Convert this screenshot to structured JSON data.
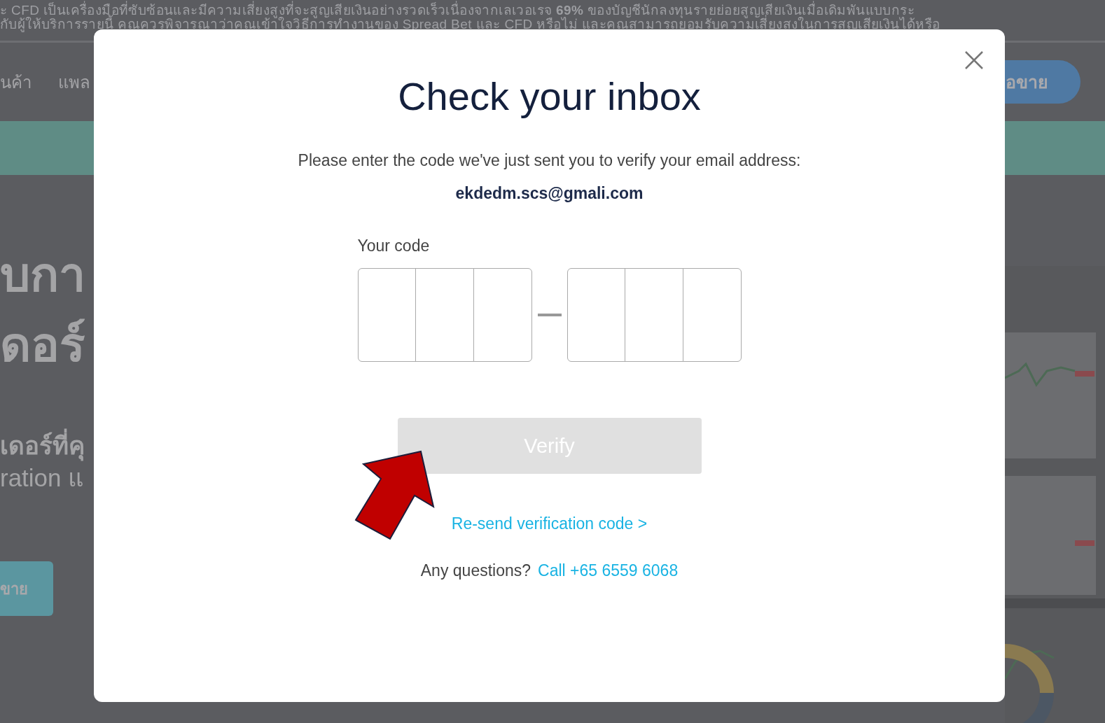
{
  "banner": {
    "lines": [
      "ะ CFD เป็นเครื่องมือที่ซับซ้อนและมีความเสี่ยงสูงที่จะสูญเสียเงินอย่างรวดเร็วเนื่องจากเลเวอเรจ **69%** ของบัญชีนักลงทุนรายย่อยสูญเสียเงินเมื่อเดิมพันแบบกระ",
      "กับผู้ให้บริการรายนี้ คุณควรพิจารณาว่าคุณเข้าใจวิธีการทำงานของ Spread Bet และ CFD หรือไม่ และคุณสามารถยอมรับความเสี่ยงสูงในการสูญเสียเงินได้หรือ"
    ]
  },
  "nav": {
    "items": [
      "นค้า",
      "แพล"
    ],
    "button": "อขาย"
  },
  "hero": {
    "heading_lines": [
      "บกา",
      "ดอร์"
    ],
    "subtitle_lines": [
      "เดอร์ที่คุ",
      "ration แ"
    ],
    "button": "ขาย",
    "screenshot": {
      "kind": "picture"
    }
  },
  "modal": {
    "title": "Check your inbox",
    "message": "Please enter the code we've just sent you to verify your email address:",
    "email": "ekdedm.scs@gmali.com",
    "code_label": "Your code",
    "code_groups": [
      {
        "cells": [
          {
            "kind": "digit"
          },
          {
            "kind": "digit"
          },
          {
            "kind": "digit"
          }
        ]
      },
      {
        "cells": [
          {
            "kind": "digit"
          },
          {
            "kind": "digit"
          },
          {
            "kind": "digit"
          }
        ]
      }
    ],
    "verify_button": {
      "label": "Verify",
      "disabled": true
    },
    "resend_link": "Re-send verification code >",
    "questions": {
      "text": "Any questions?",
      "link": "Call +65 6559 6068"
    }
  }
}
